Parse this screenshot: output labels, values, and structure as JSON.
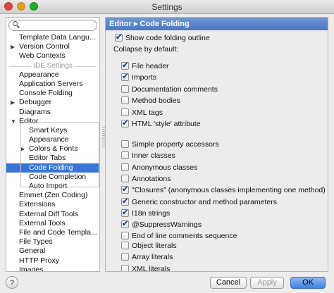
{
  "window": {
    "title": "Settings"
  },
  "search": {
    "placeholder": ""
  },
  "tree": {
    "items": [
      {
        "label": "Template Data Langu...",
        "arrow": "",
        "indent": false,
        "selected": false,
        "header": false
      },
      {
        "label": "Version Control",
        "arrow": "▶",
        "indent": false,
        "selected": false,
        "header": false
      },
      {
        "label": "Web Contexts",
        "arrow": "",
        "indent": false,
        "selected": false,
        "header": false
      },
      {
        "label": "IDE Settings",
        "arrow": "",
        "indent": false,
        "selected": false,
        "header": true
      },
      {
        "label": "Appearance",
        "arrow": "",
        "indent": false,
        "selected": false,
        "header": false
      },
      {
        "label": "Application Servers",
        "arrow": "",
        "indent": false,
        "selected": false,
        "header": false
      },
      {
        "label": "Console Folding",
        "arrow": "",
        "indent": false,
        "selected": false,
        "header": false
      },
      {
        "label": "Debugger",
        "arrow": "▶",
        "indent": false,
        "selected": false,
        "header": false
      },
      {
        "label": "Diagrams",
        "arrow": "",
        "indent": false,
        "selected": false,
        "header": false
      },
      {
        "label": "Editor",
        "arrow": "▼",
        "indent": false,
        "selected": false,
        "header": false
      },
      {
        "label": "Smart Keys",
        "arrow": "",
        "indent": true,
        "selected": false,
        "header": false
      },
      {
        "label": "Appearance",
        "arrow": "",
        "indent": true,
        "selected": false,
        "header": false
      },
      {
        "label": "Colors & Fonts",
        "arrow": "▶",
        "indent": true,
        "selected": false,
        "header": false
      },
      {
        "label": "Editor Tabs",
        "arrow": "",
        "indent": true,
        "selected": false,
        "header": false
      },
      {
        "label": "Code Folding",
        "arrow": "",
        "indent": true,
        "selected": true,
        "header": false
      },
      {
        "label": "Code Completion",
        "arrow": "",
        "indent": true,
        "selected": false,
        "header": false
      },
      {
        "label": "Auto Import",
        "arrow": "",
        "indent": true,
        "selected": false,
        "header": false
      },
      {
        "label": "Emmet (Zen Coding)",
        "arrow": "",
        "indent": false,
        "selected": false,
        "header": false
      },
      {
        "label": "Extensions",
        "arrow": "",
        "indent": false,
        "selected": false,
        "header": false
      },
      {
        "label": "External Diff Tools",
        "arrow": "",
        "indent": false,
        "selected": false,
        "header": false
      },
      {
        "label": "External Tools",
        "arrow": "",
        "indent": false,
        "selected": false,
        "header": false
      },
      {
        "label": "File and Code Templa...",
        "arrow": "",
        "indent": false,
        "selected": false,
        "header": false
      },
      {
        "label": "File Types",
        "arrow": "",
        "indent": false,
        "selected": false,
        "header": false
      },
      {
        "label": "General",
        "arrow": "",
        "indent": false,
        "selected": false,
        "header": false
      },
      {
        "label": "HTTP Proxy",
        "arrow": "",
        "indent": false,
        "selected": false,
        "header": false
      },
      {
        "label": "Images",
        "arrow": "",
        "indent": false,
        "selected": false,
        "header": false
      }
    ]
  },
  "panel": {
    "breadcrumb": "Editor ▸ Code Folding",
    "show_outline": {
      "label": "Show code folding outline",
      "checked": true
    },
    "collapse_label": "Collapse by default:",
    "groups": [
      [
        {
          "label": "File header",
          "checked": true
        },
        {
          "label": "Imports",
          "checked": true
        },
        {
          "label": "Documentation comments",
          "checked": false
        },
        {
          "label": "Method bodies",
          "checked": false
        }
      ],
      [
        {
          "label": "XML tags",
          "checked": false
        },
        {
          "label": "HTML 'style' attribute",
          "checked": true
        }
      ],
      [
        {
          "label": "Simple property accessors",
          "checked": false
        },
        {
          "label": "Inner classes",
          "checked": false
        },
        {
          "label": "Anonymous classes",
          "checked": false
        },
        {
          "label": "Annotations",
          "checked": false
        },
        {
          "label": "\"Closures\" (anonymous classes implementing one method)",
          "checked": true
        },
        {
          "label": "Generic constructor and method parameters",
          "checked": true
        },
        {
          "label": "I18n strings",
          "checked": true
        },
        {
          "label": "@SuppressWarnings",
          "checked": true
        },
        {
          "label": "End of line comments sequence",
          "checked": false
        }
      ],
      [
        {
          "label": "Object literals",
          "checked": false
        },
        {
          "label": "Array literals",
          "checked": false
        },
        {
          "label": "XML literals",
          "checked": false
        }
      ]
    ]
  },
  "buttons": {
    "help": "?",
    "cancel": "Cancel",
    "apply": "Apply",
    "ok": "OK"
  }
}
